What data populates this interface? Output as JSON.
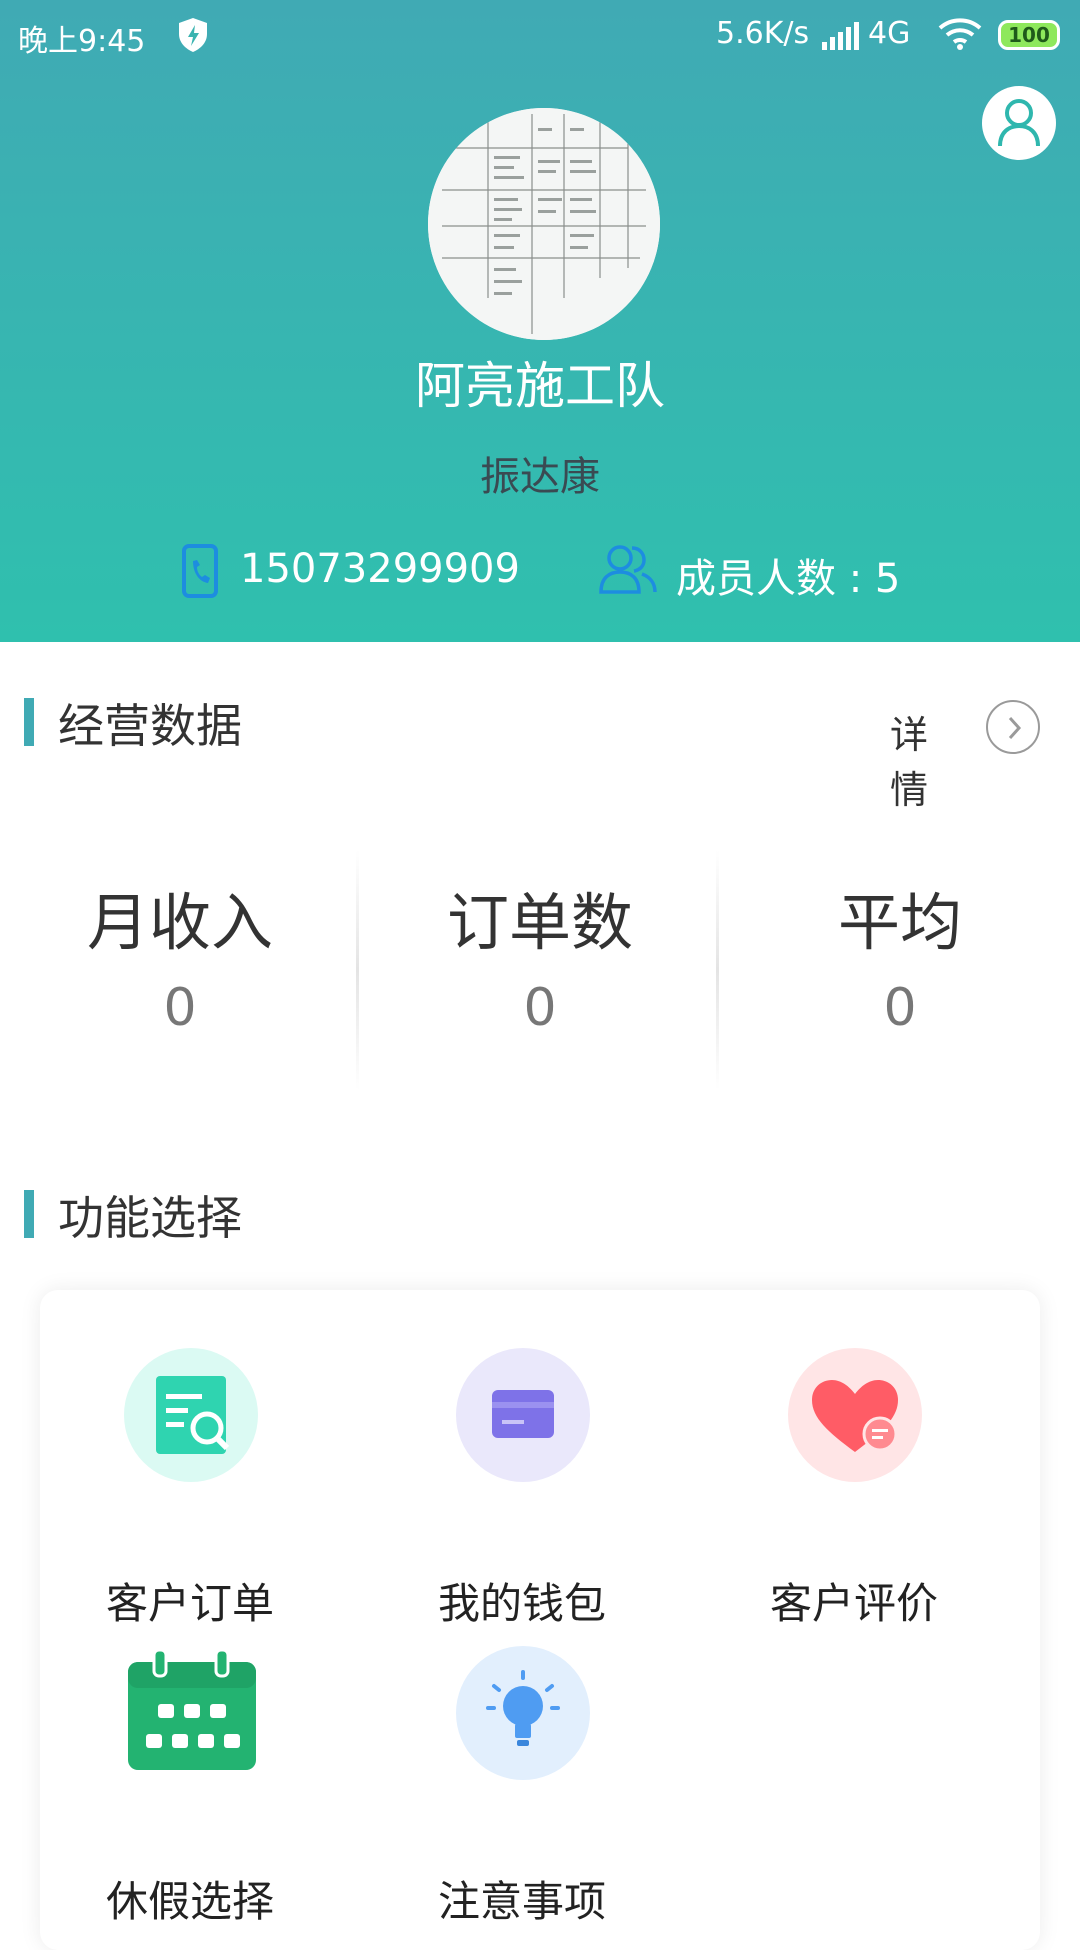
{
  "status_bar": {
    "time": "晚上9:45",
    "speed": "5.6K/s",
    "network": "4G",
    "battery": "100"
  },
  "header": {
    "team_name": "阿亮施工队",
    "leader_name": "振达康",
    "phone": "15073299909",
    "members": "成员人数 : 5"
  },
  "business": {
    "title": "经营数据",
    "detail_label": "详情",
    "stats": [
      {
        "label": "月收入",
        "value": "0"
      },
      {
        "label": "订单数",
        "value": "0"
      },
      {
        "label": "平均",
        "value": "0"
      }
    ]
  },
  "functions": {
    "title": "功能选择",
    "items": [
      {
        "label": "客户订单",
        "icon": "order-search-icon",
        "color": "#2fd4b0"
      },
      {
        "label": "我的钱包",
        "icon": "wallet-card-icon",
        "color": "#7e72e8"
      },
      {
        "label": "客户评价",
        "icon": "heart-comment-icon",
        "color": "#ff5c66"
      },
      {
        "label": "休假选择",
        "icon": "calendar-icon",
        "color": "#23b371"
      },
      {
        "label": "注意事项",
        "icon": "lightbulb-icon",
        "color": "#4f9cf2"
      }
    ]
  },
  "colors": {
    "header_top": "#40aab4",
    "header_bottom": "#2fc0ae",
    "accent": "#40aab4"
  }
}
